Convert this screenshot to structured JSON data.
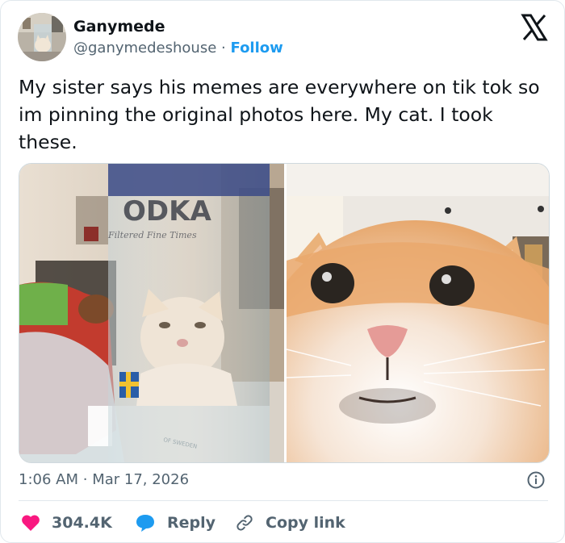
{
  "author": {
    "name": "Ganymede",
    "handle": "@ganymedeshouse",
    "separator": "·",
    "follow_label": "Follow"
  },
  "tweet": {
    "text": "My sister says his memes are everywhere on tik tok so im pinning the original photos here. My cat. I took these."
  },
  "photos": {
    "left": {
      "bottle_text": "ODKA",
      "bottle_subtext": "Filtered Fine Times",
      "bottle_bottom_text": "OF SWEDEN"
    },
    "right": {}
  },
  "meta": {
    "time": "1:06 AM",
    "separator": "·",
    "date": "Mar 17, 2026"
  },
  "actions": {
    "likes": "304.4K",
    "reply_label": "Reply",
    "copy_link_label": "Copy link"
  },
  "colors": {
    "accent": "#1d9bf0",
    "like": "#f91880",
    "muted": "#536471",
    "text": "#0f1419"
  },
  "icons": [
    "x-logo-icon",
    "info-icon",
    "heart-icon",
    "reply-bubble-icon",
    "link-icon"
  ]
}
